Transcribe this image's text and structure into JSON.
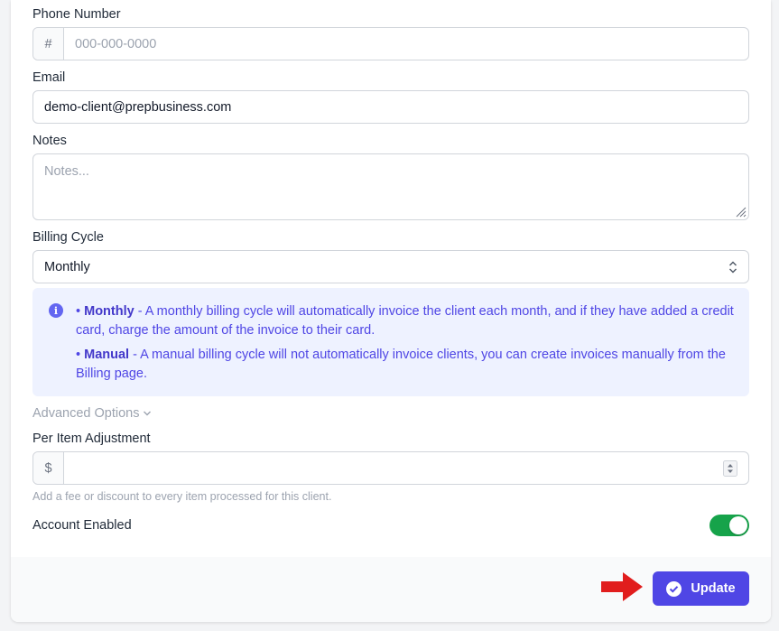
{
  "form": {
    "phone": {
      "label": "Phone Number",
      "prefix": "#",
      "placeholder": "000-000-0000",
      "value": ""
    },
    "email": {
      "label": "Email",
      "value": "demo-client@prepbusiness.com"
    },
    "notes": {
      "label": "Notes",
      "placeholder": "Notes...",
      "value": ""
    },
    "billing_cycle": {
      "label": "Billing Cycle",
      "selected": "Monthly",
      "info": [
        {
          "title": "Monthly",
          "text": " - A monthly billing cycle will automatically invoice the client each month, and if they have added a credit card, charge the amount of the invoice to their card."
        },
        {
          "title": "Manual",
          "text": " - A manual billing cycle will not automatically invoice clients, you can create invoices manually from the Billing page."
        }
      ]
    },
    "advanced_options": {
      "label": "Advanced Options"
    },
    "per_item_adjustment": {
      "label": "Per Item Adjustment",
      "prefix": "$",
      "value": "",
      "hint": "Add a fee or discount to every item processed for this client."
    },
    "account_enabled": {
      "label": "Account Enabled",
      "enabled": true
    }
  },
  "footer": {
    "update_label": "Update"
  },
  "colors": {
    "accent": "#4f46e5",
    "toggle_on": "#16a34a",
    "info_bg": "#eef2ff",
    "arrow": "#e11d1d"
  },
  "icons": [
    "info-icon",
    "chevron-down-icon",
    "select-chevrons-icon",
    "spinner-arrows-icon",
    "check-circle-icon",
    "red-arrow-icon"
  ]
}
